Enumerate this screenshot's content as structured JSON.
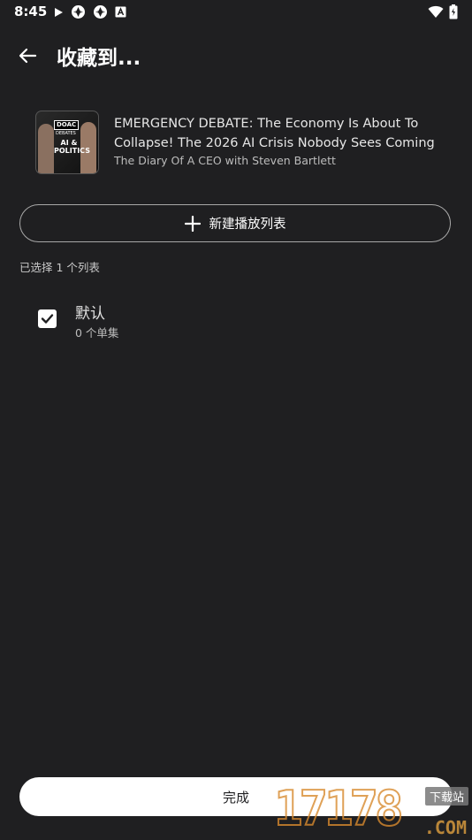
{
  "status_bar": {
    "time": "8:45"
  },
  "header": {
    "title": "收藏到..."
  },
  "episode": {
    "title": "EMERGENCY DEBATE: The Economy Is About To Collapse! The 2026 AI Crisis Nobody Sees Coming",
    "podcast": "The Diary Of A CEO with Steven Bartlett",
    "art_text": {
      "logo": "DOAC",
      "sub": "DEBATES",
      "topic": "AI & POLITICS"
    }
  },
  "new_playlist": {
    "label": "新建播放列表"
  },
  "selection": {
    "summary": "已选择 1 个列表"
  },
  "playlists": [
    {
      "name": "默认",
      "count": "0 个单集",
      "checked": true
    }
  ],
  "footer": {
    "done_label": "完成"
  },
  "watermark": {
    "digits": "17178",
    "badge": "下载站",
    "com": ".COM"
  },
  "colors": {
    "background": "#1f1f21",
    "button_bg": "#ffffff",
    "outline": "#a8a8a8"
  }
}
